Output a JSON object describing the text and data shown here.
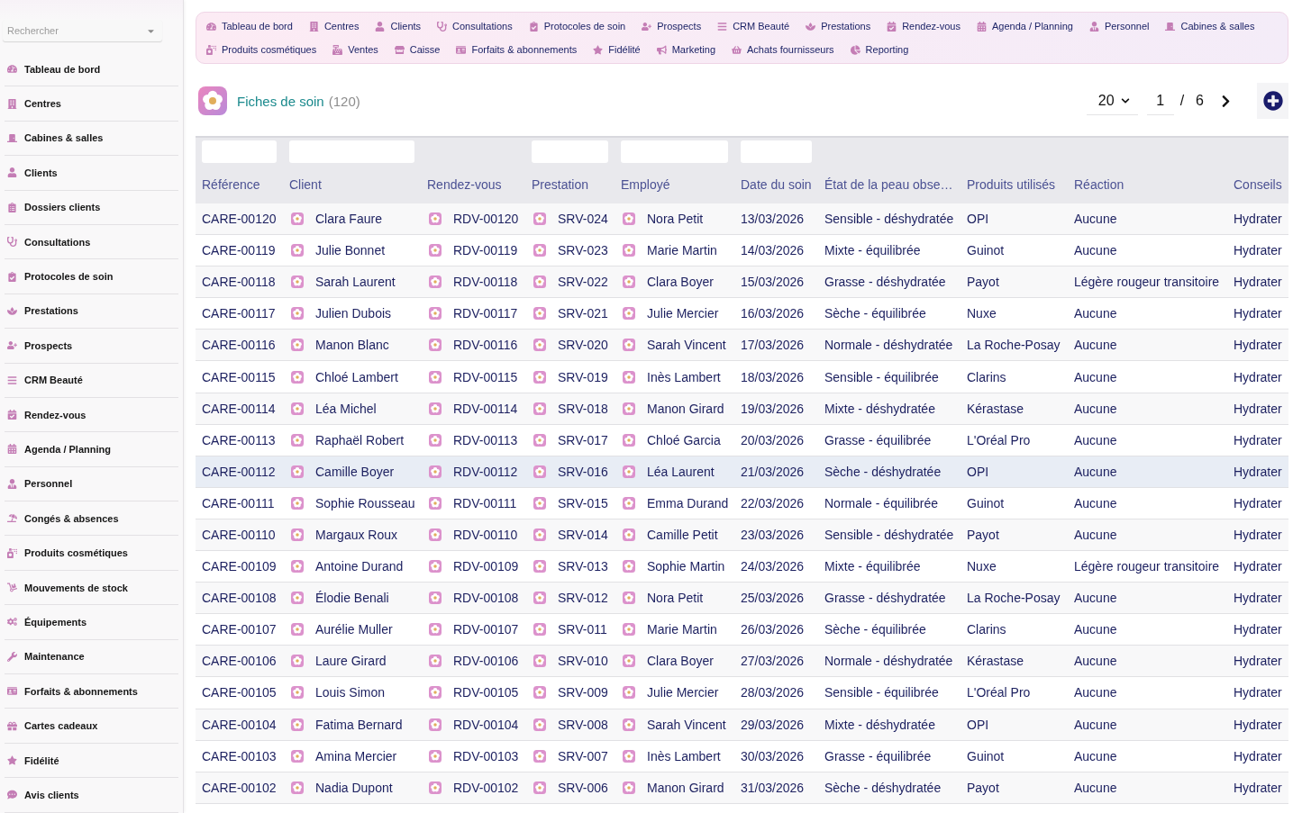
{
  "sidebar": {
    "search": {
      "placeholder": "Rechercher"
    },
    "items": [
      {
        "label": "Tableau de bord"
      },
      {
        "label": "Centres"
      },
      {
        "label": "Cabines & salles"
      },
      {
        "label": "Clients"
      },
      {
        "label": "Dossiers clients"
      },
      {
        "label": "Consultations"
      },
      {
        "label": "Protocoles de soin"
      },
      {
        "label": "Prestations"
      },
      {
        "label": "Prospects"
      },
      {
        "label": "CRM Beauté"
      },
      {
        "label": "Rendez-vous"
      },
      {
        "label": "Agenda / Planning"
      },
      {
        "label": "Personnel"
      },
      {
        "label": "Congés & absences"
      },
      {
        "label": "Produits cosmétiques"
      },
      {
        "label": "Mouvements de stock"
      },
      {
        "label": "Équipements"
      },
      {
        "label": "Maintenance"
      },
      {
        "label": "Forfaits & abonnements"
      },
      {
        "label": "Cartes cadeaux"
      },
      {
        "label": "Fidélité"
      },
      {
        "label": "Avis clients"
      }
    ]
  },
  "nav": {
    "items": [
      {
        "label": "Tableau de bord"
      },
      {
        "label": "Centres"
      },
      {
        "label": "Clients"
      },
      {
        "label": "Consultations"
      },
      {
        "label": "Protocoles de soin"
      },
      {
        "label": "Prospects"
      },
      {
        "label": "CRM Beauté"
      },
      {
        "label": "Prestations"
      },
      {
        "label": "Rendez-vous"
      },
      {
        "label": "Agenda / Planning"
      },
      {
        "label": "Personnel"
      },
      {
        "label": "Cabines & salles"
      },
      {
        "label": "Produits cosmétiques"
      },
      {
        "label": "Ventes"
      },
      {
        "label": "Caisse"
      },
      {
        "label": "Forfaits & abonnements"
      },
      {
        "label": "Fidélité"
      },
      {
        "label": "Marketing"
      },
      {
        "label": "Achats fournisseurs"
      },
      {
        "label": "Reporting"
      }
    ]
  },
  "page": {
    "title": "Fiches de soin",
    "count": "(120)"
  },
  "pagination": {
    "page_size": "20",
    "page": "1",
    "separator": "/",
    "total_pages": "6"
  },
  "table": {
    "columns": [
      {
        "label": "Référence",
        "kind": "text",
        "filter": true
      },
      {
        "label": "Client",
        "kind": "link",
        "filter": true
      },
      {
        "label": "Rendez-vous",
        "kind": "link",
        "filter": false
      },
      {
        "label": "Prestation",
        "kind": "link",
        "filter": true
      },
      {
        "label": "Employé",
        "kind": "link",
        "filter": true
      },
      {
        "label": "Date du soin",
        "kind": "text",
        "filter": true
      },
      {
        "label": "État de la peau obse…",
        "kind": "text",
        "filter": false
      },
      {
        "label": "Produits utilisés",
        "kind": "text",
        "filter": false
      },
      {
        "label": "Réaction",
        "kind": "text",
        "filter": false
      },
      {
        "label": "Conseils",
        "kind": "text",
        "filter": false
      }
    ],
    "rows": [
      {
        "selected": false,
        "cells": [
          "CARE-00120",
          "Clara Faure",
          "RDV-00120",
          "SRV-024",
          "Nora Petit",
          "13/03/2026",
          "Sensible - déshydratée",
          "OPI",
          "Aucune",
          "Hydrater"
        ]
      },
      {
        "selected": false,
        "cells": [
          "CARE-00119",
          "Julie Bonnet",
          "RDV-00119",
          "SRV-023",
          "Marie Martin",
          "14/03/2026",
          "Mixte - équilibrée",
          "Guinot",
          "Aucune",
          "Hydrater"
        ]
      },
      {
        "selected": false,
        "cells": [
          "CARE-00118",
          "Sarah Laurent",
          "RDV-00118",
          "SRV-022",
          "Clara Boyer",
          "15/03/2026",
          "Grasse - déshydratée",
          "Payot",
          "Légère rougeur transitoire",
          "Hydrater"
        ]
      },
      {
        "selected": false,
        "cells": [
          "CARE-00117",
          "Julien Dubois",
          "RDV-00117",
          "SRV-021",
          "Julie Mercier",
          "16/03/2026",
          "Sèche - équilibrée",
          "Nuxe",
          "Aucune",
          "Hydrater"
        ]
      },
      {
        "selected": false,
        "cells": [
          "CARE-00116",
          "Manon Blanc",
          "RDV-00116",
          "SRV-020",
          "Sarah Vincent",
          "17/03/2026",
          "Normale - déshydratée",
          "La Roche-Posay",
          "Aucune",
          "Hydrater"
        ]
      },
      {
        "selected": false,
        "cells": [
          "CARE-00115",
          "Chloé Lambert",
          "RDV-00115",
          "SRV-019",
          "Inès Lambert",
          "18/03/2026",
          "Sensible - équilibrée",
          "Clarins",
          "Aucune",
          "Hydrater"
        ]
      },
      {
        "selected": false,
        "cells": [
          "CARE-00114",
          "Léa Michel",
          "RDV-00114",
          "SRV-018",
          "Manon Girard",
          "19/03/2026",
          "Mixte - déshydratée",
          "Kérastase",
          "Aucune",
          "Hydrater"
        ]
      },
      {
        "selected": false,
        "cells": [
          "CARE-00113",
          "Raphaël Robert",
          "RDV-00113",
          "SRV-017",
          "Chloé Garcia",
          "20/03/2026",
          "Grasse - équilibrée",
          "L'Oréal Pro",
          "Aucune",
          "Hydrater"
        ]
      },
      {
        "selected": true,
        "cells": [
          "CARE-00112",
          "Camille Boyer",
          "RDV-00112",
          "SRV-016",
          "Léa Laurent",
          "21/03/2026",
          "Sèche - déshydratée",
          "OPI",
          "Aucune",
          "Hydrater"
        ]
      },
      {
        "selected": false,
        "cells": [
          "CARE-00111",
          "Sophie Rousseau",
          "RDV-00111",
          "SRV-015",
          "Emma Durand",
          "22/03/2026",
          "Normale - équilibrée",
          "Guinot",
          "Aucune",
          "Hydrater"
        ]
      },
      {
        "selected": false,
        "cells": [
          "CARE-00110",
          "Margaux Roux",
          "RDV-00110",
          "SRV-014",
          "Camille Petit",
          "23/03/2026",
          "Sensible - déshydratée",
          "Payot",
          "Aucune",
          "Hydrater"
        ]
      },
      {
        "selected": false,
        "cells": [
          "CARE-00109",
          "Antoine Durand",
          "RDV-00109",
          "SRV-013",
          "Sophie Martin",
          "24/03/2026",
          "Mixte - équilibrée",
          "Nuxe",
          "Légère rougeur transitoire",
          "Hydrater"
        ]
      },
      {
        "selected": false,
        "cells": [
          "CARE-00108",
          "Élodie Benali",
          "RDV-00108",
          "SRV-012",
          "Nora Petit",
          "25/03/2026",
          "Grasse - déshydratée",
          "La Roche-Posay",
          "Aucune",
          "Hydrater"
        ]
      },
      {
        "selected": false,
        "cells": [
          "CARE-00107",
          "Aurélie Muller",
          "RDV-00107",
          "SRV-011",
          "Marie Martin",
          "26/03/2026",
          "Sèche - équilibrée",
          "Clarins",
          "Aucune",
          "Hydrater"
        ]
      },
      {
        "selected": false,
        "cells": [
          "CARE-00106",
          "Laure Girard",
          "RDV-00106",
          "SRV-010",
          "Clara Boyer",
          "27/03/2026",
          "Normale - déshydratée",
          "Kérastase",
          "Aucune",
          "Hydrater"
        ]
      },
      {
        "selected": false,
        "cells": [
          "CARE-00105",
          "Louis Simon",
          "RDV-00105",
          "SRV-009",
          "Julie Mercier",
          "28/03/2026",
          "Sensible - équilibrée",
          "L'Oréal Pro",
          "Aucune",
          "Hydrater"
        ]
      },
      {
        "selected": false,
        "cells": [
          "CARE-00104",
          "Fatima Bernard",
          "RDV-00104",
          "SRV-008",
          "Sarah Vincent",
          "29/03/2026",
          "Mixte - déshydratée",
          "OPI",
          "Aucune",
          "Hydrater"
        ]
      },
      {
        "selected": false,
        "cells": [
          "CARE-00103",
          "Amina Mercier",
          "RDV-00103",
          "SRV-007",
          "Inès Lambert",
          "30/03/2026",
          "Grasse - équilibrée",
          "Guinot",
          "Aucune",
          "Hydrater"
        ]
      },
      {
        "selected": false,
        "cells": [
          "CARE-00102",
          "Nadia Dupont",
          "RDV-00102",
          "SRV-006",
          "Manon Girard",
          "31/03/2026",
          "Sèche - déshydratée",
          "Payot",
          "Aucune",
          "Hydrater"
        ]
      }
    ]
  }
}
